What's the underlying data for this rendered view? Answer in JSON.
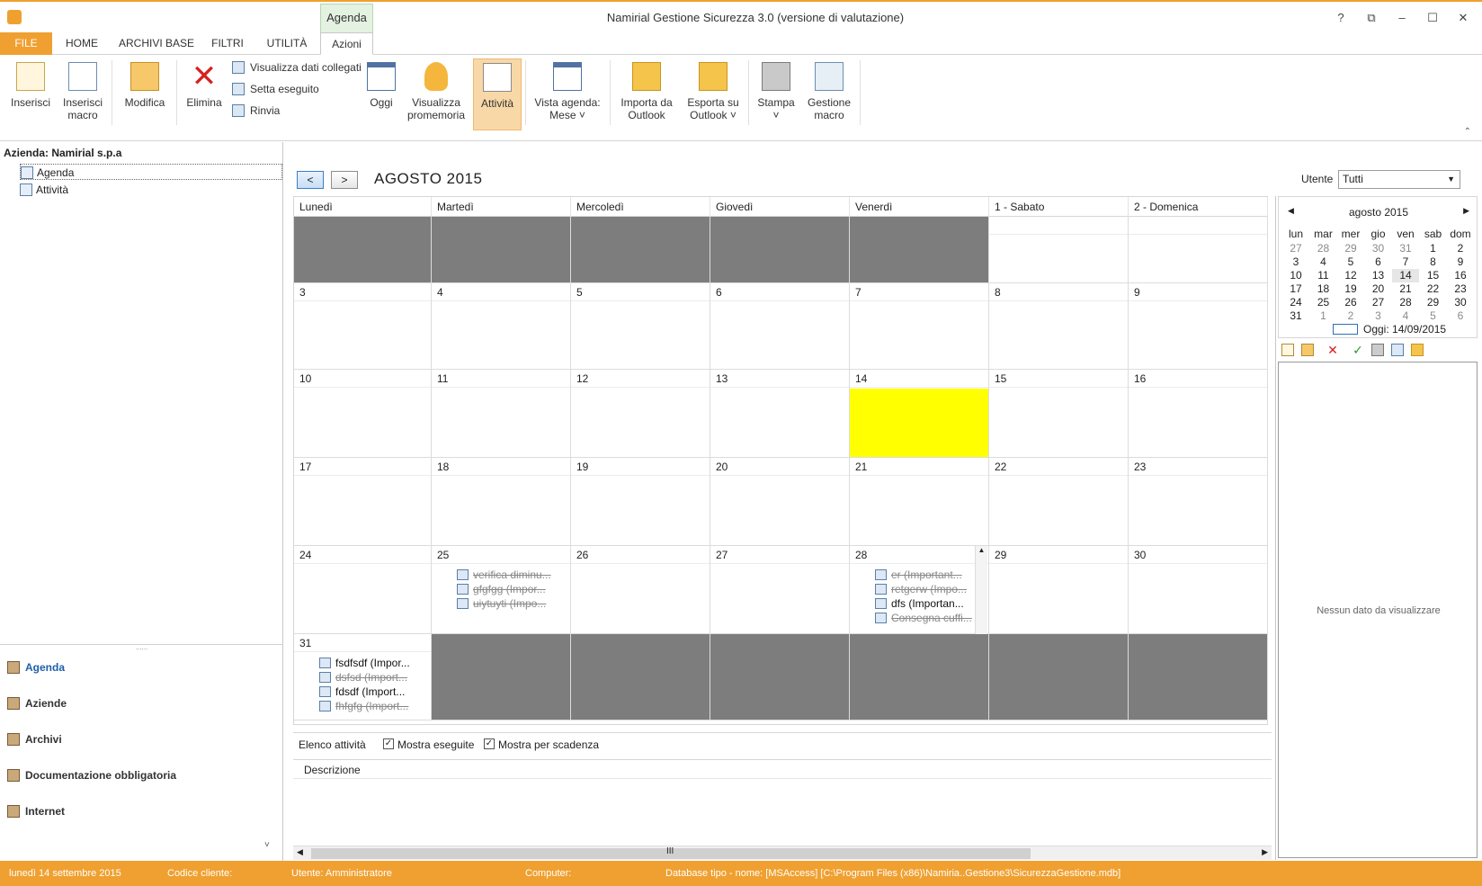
{
  "window": {
    "title": "Namirial Gestione Sicurezza 3.0 (versione di valutazione)",
    "context_tab": "Agenda",
    "controls": [
      "?",
      "⧉",
      "–",
      "☐",
      "✕"
    ]
  },
  "tabs": [
    "FILE",
    "HOME",
    "ARCHIVI BASE",
    "FILTRI",
    "UTILITÀ",
    "Azioni"
  ],
  "ribbon": {
    "inserisci": "Inserisci",
    "inserisci_macro": [
      "Inserisci",
      "macro"
    ],
    "modifica": "Modifica",
    "elimina": "Elimina",
    "visualizza_dati": "Visualizza dati collegati",
    "setta_eseguito": "Setta eseguito",
    "rinvia": "Rinvia",
    "oggi": "Oggi",
    "visualizza_promemoria": [
      "Visualizza",
      "promemoria"
    ],
    "attivita": "Attività",
    "vista_agenda": [
      "Vista agenda:",
      "Mese ˅"
    ],
    "importa": [
      "Importa da",
      "Outlook"
    ],
    "esporta": [
      "Esporta su",
      "Outlook ˅"
    ],
    "stampa": [
      "Stampa",
      "˅"
    ],
    "gestione_macro": [
      "Gestione",
      "macro"
    ]
  },
  "left": {
    "company": "Azienda: Namirial s.p.a",
    "tree": [
      "Agenda",
      "Attività"
    ],
    "nav": [
      "Agenda",
      "Aziende",
      "Archivi",
      "Documentazione obbligatoria",
      "Internet"
    ],
    "splitter": "......",
    "more": "˅"
  },
  "calendar": {
    "prev": "<",
    "next": ">",
    "month_title": "AGOSTO 2015",
    "user_label": "Utente",
    "user_value": "Tutti",
    "daynames": [
      "Lunedì",
      "Martedì",
      "Mercoledì",
      "Giovedì",
      "Venerdì",
      "1 - Sabato",
      "2 - Domenica"
    ],
    "weeks": [
      [
        {
          "d": "",
          "out": true
        },
        {
          "d": "",
          "out": true
        },
        {
          "d": "",
          "out": true
        },
        {
          "d": "",
          "out": true
        },
        {
          "d": "",
          "out": true
        },
        {
          "d": ""
        },
        {
          "d": ""
        }
      ],
      [
        {
          "d": "3"
        },
        {
          "d": "4"
        },
        {
          "d": "5"
        },
        {
          "d": "6"
        },
        {
          "d": "7"
        },
        {
          "d": "8"
        },
        {
          "d": "9"
        }
      ],
      [
        {
          "d": "10"
        },
        {
          "d": "11"
        },
        {
          "d": "12"
        },
        {
          "d": "13"
        },
        {
          "d": "14",
          "today": true
        },
        {
          "d": "15"
        },
        {
          "d": "16"
        }
      ],
      [
        {
          "d": "17"
        },
        {
          "d": "18"
        },
        {
          "d": "19"
        },
        {
          "d": "20"
        },
        {
          "d": "21"
        },
        {
          "d": "22"
        },
        {
          "d": "23"
        }
      ],
      [
        {
          "d": "24"
        },
        {
          "d": "25",
          "events": [
            {
              "t": "verifica diminu...",
              "done": true
            },
            {
              "t": "gfgfgg  (Impor...",
              "done": true
            },
            {
              "t": "uiytuyti  (Impo...",
              "done": true
            }
          ]
        },
        {
          "d": "26"
        },
        {
          "d": "27"
        },
        {
          "d": "28",
          "scroll": true,
          "events": [
            {
              "t": "er  (Important...",
              "done": true
            },
            {
              "t": "retgerw  (Impo...",
              "done": true
            },
            {
              "t": "dfs  (Importan...",
              "done": false
            },
            {
              "t": "Consegna cuffi...",
              "done": true
            }
          ]
        },
        {
          "d": "29"
        },
        {
          "d": "30"
        }
      ],
      [
        {
          "d": "31",
          "events": [
            {
              "t": "fsdfsdf  (Impor...",
              "done": false
            },
            {
              "t": "dsfsd  (Import...",
              "done": true
            },
            {
              "t": "fdsdf  (Import...",
              "done": false
            },
            {
              "t": "fhfgfg  (Import...",
              "done": true
            }
          ]
        },
        {
          "d": "",
          "out": true
        },
        {
          "d": "",
          "out": true
        },
        {
          "d": "",
          "out": true
        },
        {
          "d": "",
          "out": true
        },
        {
          "d": "",
          "out": true
        },
        {
          "d": "",
          "out": true
        }
      ]
    ]
  },
  "activity": {
    "label": "Elenco attività",
    "show_done": "Mostra eseguite",
    "show_due": "Mostra per scadenza",
    "column": "Descrizione",
    "scroll_mark": "III"
  },
  "mini": {
    "title": "agosto 2015",
    "weekdays": [
      "lun",
      "mar",
      "mer",
      "gio",
      "ven",
      "sab",
      "dom"
    ],
    "days": [
      [
        "27",
        "28",
        "29",
        "30",
        "31",
        "1",
        "2"
      ],
      [
        "3",
        "4",
        "5",
        "6",
        "7",
        "8",
        "9"
      ],
      [
        "10",
        "11",
        "12",
        "13",
        "14",
        "15",
        "16"
      ],
      [
        "17",
        "18",
        "19",
        "20",
        "21",
        "22",
        "23"
      ],
      [
        "24",
        "25",
        "26",
        "27",
        "28",
        "29",
        "30"
      ],
      [
        "31",
        "1",
        "2",
        "3",
        "4",
        "5",
        "6"
      ]
    ],
    "today_label": "Oggi: 14/09/2015",
    "empty": "Nessun dato da visualizzare"
  },
  "status": {
    "date": "lunedì 14 settembre 2015",
    "client": "Codice cliente: ",
    "user": "Utente: Amministratore",
    "computer": "Computer: ",
    "db": "Database tipo - nome: [MSAccess] [C:\\Program Files (x86)\\Namiria..Gestione3\\SicurezzaGestione.mdb]"
  }
}
